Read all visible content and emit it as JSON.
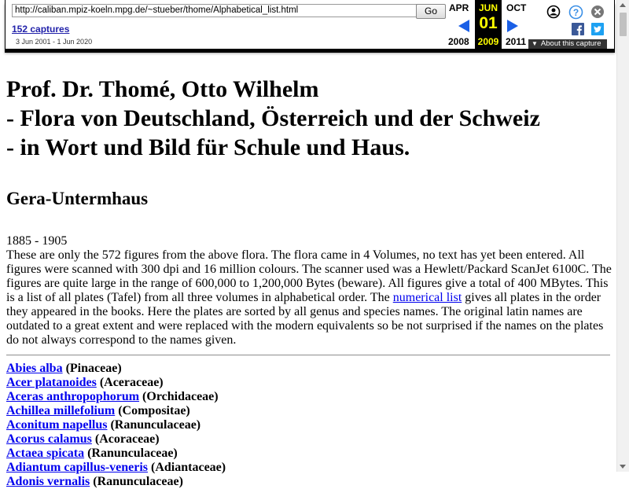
{
  "toolbar": {
    "url": "http://caliban.mpiz-koeln.mpg.de/~stueber/thome/Alphabetical_list.html",
    "go_label": "Go",
    "captures": "152 captures",
    "range": "3 Jun 2001 - 1 Jun 2020",
    "prev_month": "APR",
    "prev_year": "2008",
    "cur_month": "JUN",
    "cur_day": "01",
    "cur_year": "2009",
    "next_month": "OCT",
    "next_year": "2011",
    "about": "About this capture",
    "icons": [
      "user-icon",
      "help-icon",
      "close-icon",
      "facebook-icon",
      "twitter-icon"
    ],
    "accent_blue": "#1a5fe6",
    "highlight_yellow": "#ffff00"
  },
  "page": {
    "title_lines": [
      "Prof. Dr. Thomé, Otto Wilhelm",
      "- Flora von Deutschland, Österreich und der Schweiz",
      "- in Wort und Bild für Schule und Haus."
    ],
    "subtitle": "Gera-Untermhaus",
    "years": "1885 - 1905",
    "intro_before_link": "These are only the 572 figures from the above flora. The flora came in 4 Volumes, no text has yet been entered. All figures were scanned with 300 dpi and 16 million colours. The scanner used was a Hewlett/Packard ScanJet 6100C. The figures are quite large in the range of 600,000 to 1,200,000 Bytes (beware). All figures give a total of 400 MBytes. This is a list of all plates (Tafel) from all three volumes in alphabetical order. The ",
    "intro_link": "numerical list",
    "intro_after_link": " gives all plates in the order they appeared in the books. Here the plates are sorted by all genus and species names. The original latin names are outdated to a great extent and were replaced with the modern equivalents so be not surprised if the names on the plates do not always correspond to the names given.",
    "plants": [
      {
        "name": "Abies alba",
        "family": "(Pinaceae)"
      },
      {
        "name": "Acer platanoides",
        "family": "(Aceraceae)"
      },
      {
        "name": "Aceras anthropophorum",
        "family": "(Orchidaceae)"
      },
      {
        "name": "Achillea millefolium",
        "family": "(Compositae)"
      },
      {
        "name": "Aconitum napellus",
        "family": "(Ranunculaceae)"
      },
      {
        "name": "Acorus calamus",
        "family": "(Acoraceae)"
      },
      {
        "name": "Actaea spicata",
        "family": "(Ranunculaceae)"
      },
      {
        "name": "Adiantum capillus-veneris",
        "family": "(Adiantaceae)"
      },
      {
        "name": "Adonis vernalis",
        "family": "(Ranunculaceae)"
      }
    ]
  }
}
